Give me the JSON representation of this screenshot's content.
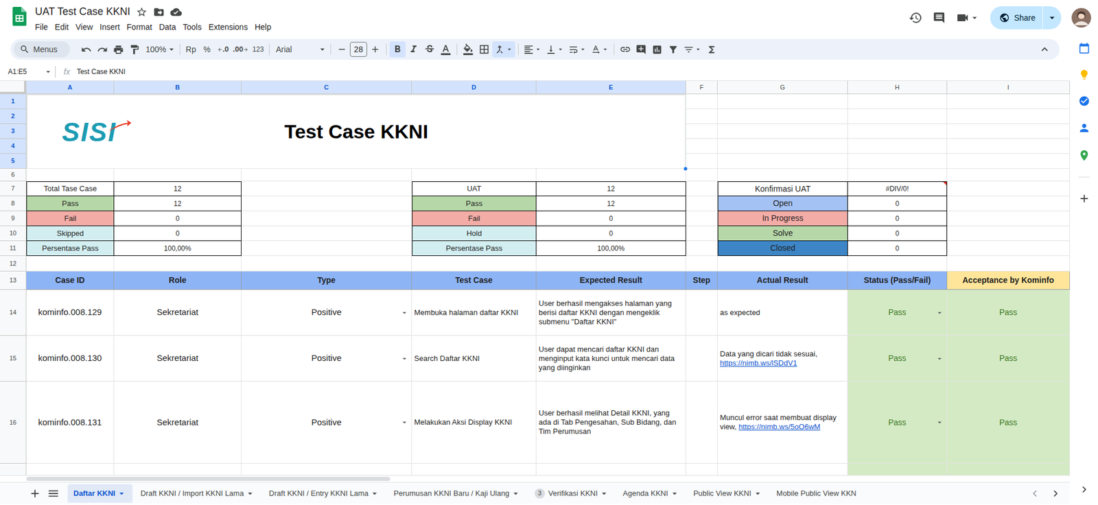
{
  "app": {
    "title": "UAT Test Case KKNI",
    "menu": [
      "File",
      "Edit",
      "View",
      "Insert",
      "Format",
      "Data",
      "Tools",
      "Extensions",
      "Help"
    ],
    "share": "Share"
  },
  "toolbar": {
    "search_placeholder": "Menus",
    "zoom": "100%",
    "currency": "Rp",
    "percent": "%",
    "decimal_decrease": ".0",
    "decimal_increase": ".00",
    "number_format": "123",
    "font": "Arial",
    "font_size": "28",
    "bold": true,
    "italic": false,
    "strikethrough": false,
    "merged": true
  },
  "formula_bar": {
    "cell_range": "A1:E5",
    "fx": "fx",
    "value": "Test Case KKNI"
  },
  "columns": [
    {
      "label": "A",
      "selected": true
    },
    {
      "label": "B",
      "selected": true
    },
    {
      "label": "C",
      "selected": true
    },
    {
      "label": "D",
      "selected": true
    },
    {
      "label": "E",
      "selected": true
    },
    {
      "label": "F",
      "selected": false
    },
    {
      "label": "G",
      "selected": false
    },
    {
      "label": "H",
      "selected": false
    },
    {
      "label": "I",
      "selected": false
    }
  ],
  "row_numbers": [
    {
      "label": "1",
      "selected": true
    },
    {
      "label": "2",
      "selected": true
    },
    {
      "label": "3",
      "selected": true
    },
    {
      "label": "4",
      "selected": true
    },
    {
      "label": "5",
      "selected": true
    },
    {
      "label": "6",
      "selected": false
    },
    {
      "label": "7",
      "selected": false
    },
    {
      "label": "8",
      "selected": false
    },
    {
      "label": "9",
      "selected": false
    },
    {
      "label": "10",
      "selected": false
    },
    {
      "label": "11",
      "selected": false
    },
    {
      "label": "12",
      "selected": false
    },
    {
      "label": "13",
      "selected": false
    },
    {
      "label": "14",
      "selected": false
    },
    {
      "label": "15",
      "selected": false
    },
    {
      "label": "16",
      "selected": false
    }
  ],
  "banner": {
    "logo": "SISI",
    "title": "Test Case KKNI",
    "selected": true
  },
  "summaries": [
    {
      "items": [
        {
          "label": "Total Tase Case",
          "value": "12",
          "color": "#ffffff",
          "error": false
        },
        {
          "label": "Pass",
          "value": "12",
          "color": "#b6d7a8",
          "error": false
        },
        {
          "label": "Fail",
          "value": "0",
          "color": "#f4aca6",
          "error": false
        },
        {
          "label": "Skipped",
          "value": "0",
          "color": "#d2eef1",
          "error": false
        },
        {
          "label": "Persentase Pass",
          "value": "100,00%",
          "color": "#d2eef1",
          "error": false
        }
      ]
    },
    {
      "items": [
        {
          "label": "UAT",
          "value": "12",
          "color": "#ffffff",
          "error": false
        },
        {
          "label": "Pass",
          "value": "12",
          "color": "#b6d7a8",
          "error": false
        },
        {
          "label": "Fail",
          "value": "0",
          "color": "#f4aca6",
          "error": false
        },
        {
          "label": "Hold",
          "value": "0",
          "color": "#d2eef1",
          "error": false
        },
        {
          "label": "Persentase Pass",
          "value": "100,00%",
          "color": "#d2eef1",
          "error": false
        }
      ]
    },
    {
      "items": [
        {
          "label": "Konfirmasi UAT",
          "value": "#DIV/0!",
          "color": "#ffffff",
          "error": true
        },
        {
          "label": "Open",
          "value": "0",
          "color": "#a4c2f4",
          "error": false
        },
        {
          "label": "In Progress",
          "value": "0",
          "color": "#f4aca6",
          "error": false
        },
        {
          "label": "Solve",
          "value": "0",
          "color": "#b6d7a8",
          "error": false
        },
        {
          "label": "Closed",
          "value": "0",
          "color": "#3d85c6",
          "error": false
        }
      ]
    }
  ],
  "table": {
    "header": [
      {
        "label": "Case ID",
        "color": "#8db4f5"
      },
      {
        "label": "Role",
        "color": "#8db4f5"
      },
      {
        "label": "Type",
        "color": "#8db4f5"
      },
      {
        "label": "Test Case",
        "color": "#8db4f5"
      },
      {
        "label": "Expected Result",
        "color": "#8db4f5"
      },
      {
        "label": "Step",
        "color": "#8db4f5"
      },
      {
        "label": "Actual Result",
        "color": "#8db4f5"
      },
      {
        "label": "Status (Pass/Fail)",
        "color": "#8db4f5"
      },
      {
        "label": "Acceptance by Kominfo",
        "color": "#ffe599"
      }
    ],
    "rows": [
      {
        "case_id": "kominfo.008.129",
        "role": "Sekretariat",
        "type": "Positive",
        "test_case": "Membuka halaman daftar KKNI",
        "expected": "User berhasil mengakses halaman yang berisi daftar KKNI dengan mengeklik submenu \"Daftar KKNI\"",
        "step": "",
        "actual_text": "as expected",
        "actual_link": "",
        "status": "Pass",
        "acceptance": "Pass"
      },
      {
        "case_id": "kominfo.008.130",
        "role": "Sekretariat",
        "type": "Positive",
        "test_case": "Search Daftar KKNI",
        "expected": "User dapat mencari daftar KKNI dan menginput kata kunci untuk mencari data yang diinginkan",
        "step": "",
        "actual_text": "Data yang dicari tidak sesuai,",
        "actual_link": "https://nimb.ws/lSDdV1",
        "status": "Pass",
        "acceptance": "Pass"
      },
      {
        "case_id": "kominfo.008.131",
        "role": "Sekretariat",
        "type": "Positive",
        "test_case": "Melakukan Aksi Display KKNI",
        "expected": "User berhasil melihat Detail KKNI, yang ada di Tab Pengesahan, Sub Bidang, dan Tim Perumusan",
        "step": "",
        "actual_text": "Muncul error saat membuat display view,",
        "actual_link": "https://nimb.ws/5oO6wM",
        "status": "Pass",
        "acceptance": "Pass"
      }
    ]
  },
  "sheets": [
    {
      "label": "Daftar KKNI",
      "selected": true,
      "badge": "",
      "truncated": false
    },
    {
      "label": "Draft KKNI / Import KKNI Lama",
      "selected": false,
      "badge": "",
      "truncated": false
    },
    {
      "label": "Draft KKNI / Entry KKNI Lama",
      "selected": false,
      "badge": "",
      "truncated": false
    },
    {
      "label": "Perumusan KKNI Baru / Kaji Ulang",
      "selected": false,
      "badge": "",
      "truncated": false
    },
    {
      "label": "Verifikasi KKNI",
      "selected": false,
      "badge": "3",
      "truncated": false
    },
    {
      "label": "Agenda KKNI",
      "selected": false,
      "badge": "",
      "truncated": false
    },
    {
      "label": "Public View KKNI",
      "selected": false,
      "badge": "",
      "truncated": false
    },
    {
      "label": "Mobile Public View KKN",
      "selected": false,
      "badge": "",
      "truncated": true
    }
  ]
}
